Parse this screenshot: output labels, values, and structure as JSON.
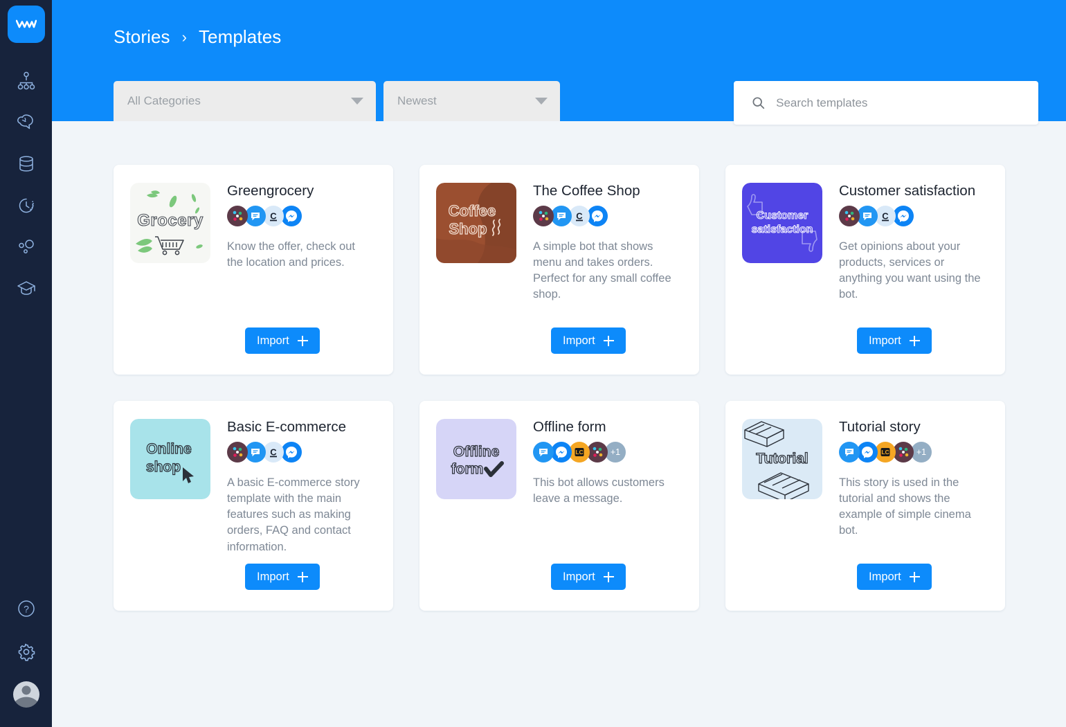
{
  "app": {
    "brand_color": "#0d8bfb",
    "sidebar_color": "#17233c",
    "page_background": "#f1f5f9",
    "logo_name": "chatbot-logo"
  },
  "sidebar": {
    "items": [
      {
        "icon": "stories-flowchart-icon",
        "label": "Stories"
      },
      {
        "icon": "brain-ai-icon",
        "label": "Training"
      },
      {
        "icon": "database-icon",
        "label": "Attributes"
      },
      {
        "icon": "history-clock-icon",
        "label": "Archives"
      },
      {
        "icon": "integrations-bubbles-icon",
        "label": "Integrations"
      },
      {
        "icon": "graduation-cap-icon",
        "label": "Tutorials"
      }
    ],
    "bottom_items": [
      {
        "icon": "help-question-icon",
        "label": "Help"
      },
      {
        "icon": "gear-icon",
        "label": "Settings"
      },
      {
        "icon": "avatar",
        "label": "Account"
      }
    ]
  },
  "header": {
    "breadcrumb": {
      "parent": "Stories",
      "separator": "›",
      "current": "Templates"
    }
  },
  "filters": {
    "category": {
      "value": "All Categories",
      "caret": "chevron-down-icon"
    },
    "sort": {
      "value": "Newest",
      "caret": "chevron-down-icon"
    }
  },
  "search": {
    "placeholder": "Search templates",
    "value": "",
    "icon": "search-icon"
  },
  "cards": [
    {
      "title": "Greengrocery",
      "description": "Know the offer, check out the location and prices.",
      "import_label": "Import",
      "thumb": "grocery-thumbnail",
      "channels": [
        "slack",
        "chat",
        "chatbot",
        "messenger"
      ],
      "more_count": ""
    },
    {
      "title": "The Coffee Shop",
      "description": "A simple bot that shows menu and takes orders. Perfect for any small coffee shop.",
      "import_label": "Import",
      "thumb": "coffee-shop-thumbnail",
      "channels": [
        "slack",
        "chat",
        "chatbot",
        "messenger"
      ],
      "more_count": ""
    },
    {
      "title": "Customer satisfaction",
      "description": "Get opinions about your products, services or anything you want using the bot.",
      "import_label": "Import",
      "thumb": "customer-satisfaction-thumbnail",
      "channels": [
        "slack",
        "chat",
        "chatbot",
        "messenger"
      ],
      "more_count": ""
    },
    {
      "title": "Basic E-commerce",
      "description": "A basic E-commerce story template with the main features such as making orders, FAQ and contact information.",
      "import_label": "Import",
      "thumb": "online-shop-thumbnail",
      "channels": [
        "slack",
        "chat",
        "chatbot",
        "messenger"
      ],
      "more_count": ""
    },
    {
      "title": "Offline form",
      "description": "This bot allows customers leave a message.",
      "import_label": "Import",
      "thumb": "offline-form-thumbnail",
      "channels": [
        "chat",
        "messenger",
        "livechat",
        "slack"
      ],
      "more_count": "+1"
    },
    {
      "title": "Tutorial story",
      "description": "This story is used in the tutorial and shows the example of simple cinema bot.",
      "import_label": "Import",
      "thumb": "tutorial-thumbnail",
      "channels": [
        "chat",
        "messenger",
        "livechat",
        "slack"
      ],
      "more_count": "+1"
    }
  ]
}
